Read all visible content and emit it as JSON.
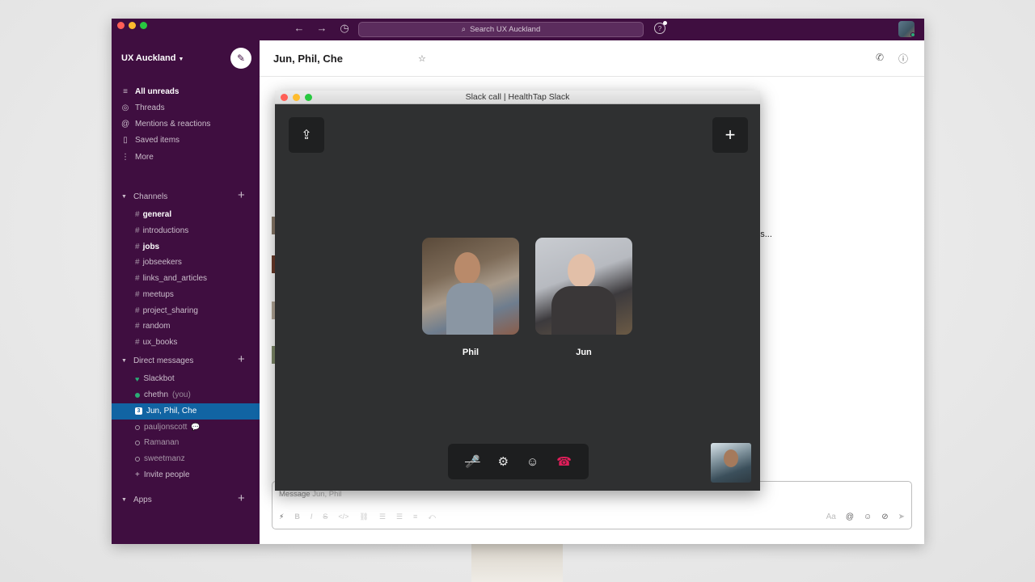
{
  "titlebar": {
    "search_placeholder": "Search UX Auckland",
    "back_icon": "←",
    "forward_icon": "→",
    "history_icon": "◷",
    "help_icon": "?"
  },
  "sidebar": {
    "workspace": "UX Auckland",
    "compose_icon": "✎",
    "top_items": [
      {
        "icon": "≡",
        "label": "All unreads"
      },
      {
        "icon": "◎",
        "label": "Threads"
      },
      {
        "icon": "@",
        "label": "Mentions & reactions"
      },
      {
        "icon": "▯",
        "label": "Saved items"
      },
      {
        "icon": "⋮",
        "label": "More"
      }
    ],
    "channels_header": "Channels",
    "channels": [
      {
        "label": "general"
      },
      {
        "label": "introductions"
      },
      {
        "label": "jobs"
      },
      {
        "label": "jobseekers"
      },
      {
        "label": "links_and_articles"
      },
      {
        "label": "meetups"
      },
      {
        "label": "project_sharing"
      },
      {
        "label": "random"
      },
      {
        "label": "ux_books"
      }
    ],
    "dm_header": "Direct messages",
    "dms": [
      {
        "label": "Slackbot"
      },
      {
        "label": "chethn",
        "suffix": "(you)"
      },
      {
        "label": "Jun, Phil, Che",
        "badge": "3"
      },
      {
        "label": "pauljonscott"
      },
      {
        "label": "Ramanan"
      },
      {
        "label": "sweetmanz"
      }
    ],
    "invite": "Invite people",
    "apps_header": "Apps",
    "plus": "+"
  },
  "header": {
    "title": "Jun, Phil, Che",
    "star_icon": "☆",
    "phone_icon": "✆",
    "info_icon": "ⓘ"
  },
  "messages": {
    "snippet": "ngs..."
  },
  "composer": {
    "placeholder_prefix": "Message",
    "placeholder_names": "Jun, Phil",
    "format_icons": [
      "⚡",
      "B",
      "I",
      "S",
      "</>",
      "⛓",
      "☰",
      "☰",
      "≡",
      "⤺"
    ],
    "right_icons": [
      "Aa",
      "@",
      "☺",
      "⊘",
      "➤"
    ]
  },
  "call": {
    "title": "Slack call | HealthTap Slack",
    "share_icon": "⇪",
    "add_icon": "+",
    "participants": [
      {
        "name": "Phil"
      },
      {
        "name": "Jun"
      }
    ],
    "controls": {
      "mute_icon": "🎤",
      "settings_icon": "⚙",
      "emoji_icon": "☺",
      "hangup_icon": "☎"
    }
  }
}
